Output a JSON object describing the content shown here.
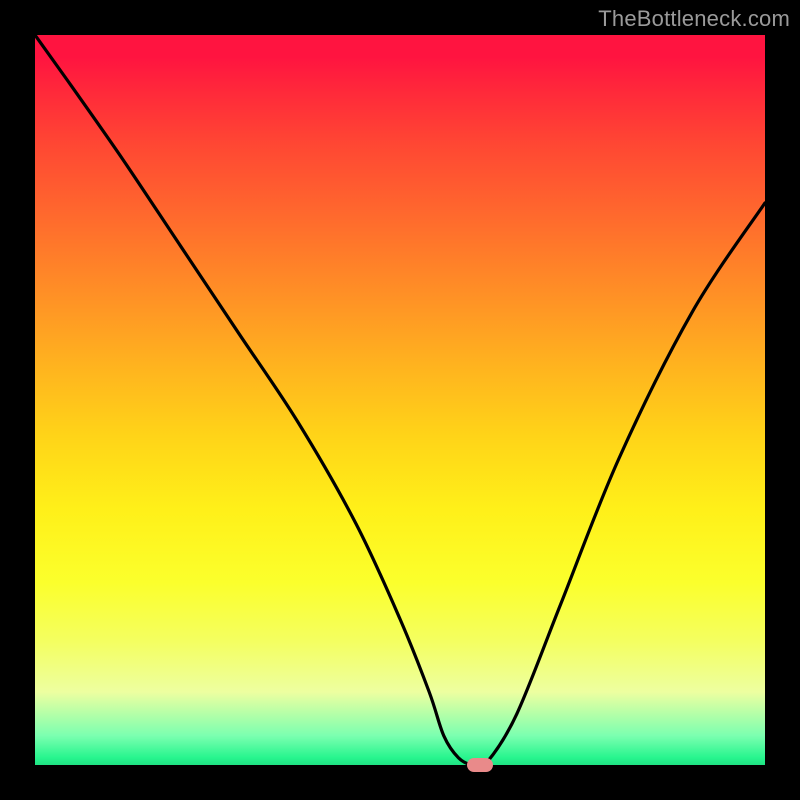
{
  "watermark": "TheBottleneck.com",
  "chart_data": {
    "type": "line",
    "title": "",
    "xlabel": "",
    "ylabel": "",
    "ylim": [
      0,
      100
    ],
    "xlim": [
      0,
      100
    ],
    "series": [
      {
        "name": "bottleneck-curve",
        "x": [
          0,
          5,
          12,
          20,
          28,
          36,
          44,
          50,
          54,
          56,
          58,
          60,
          62,
          66,
          72,
          80,
          90,
          100
        ],
        "values": [
          100,
          93,
          83,
          71,
          59,
          47,
          33,
          20,
          10,
          4,
          1,
          0,
          0.5,
          7,
          22,
          42,
          62,
          77
        ]
      }
    ],
    "marker": {
      "x": 61,
      "y": 0
    },
    "gradient_note": "vertical red→orange→yellow→green background"
  }
}
